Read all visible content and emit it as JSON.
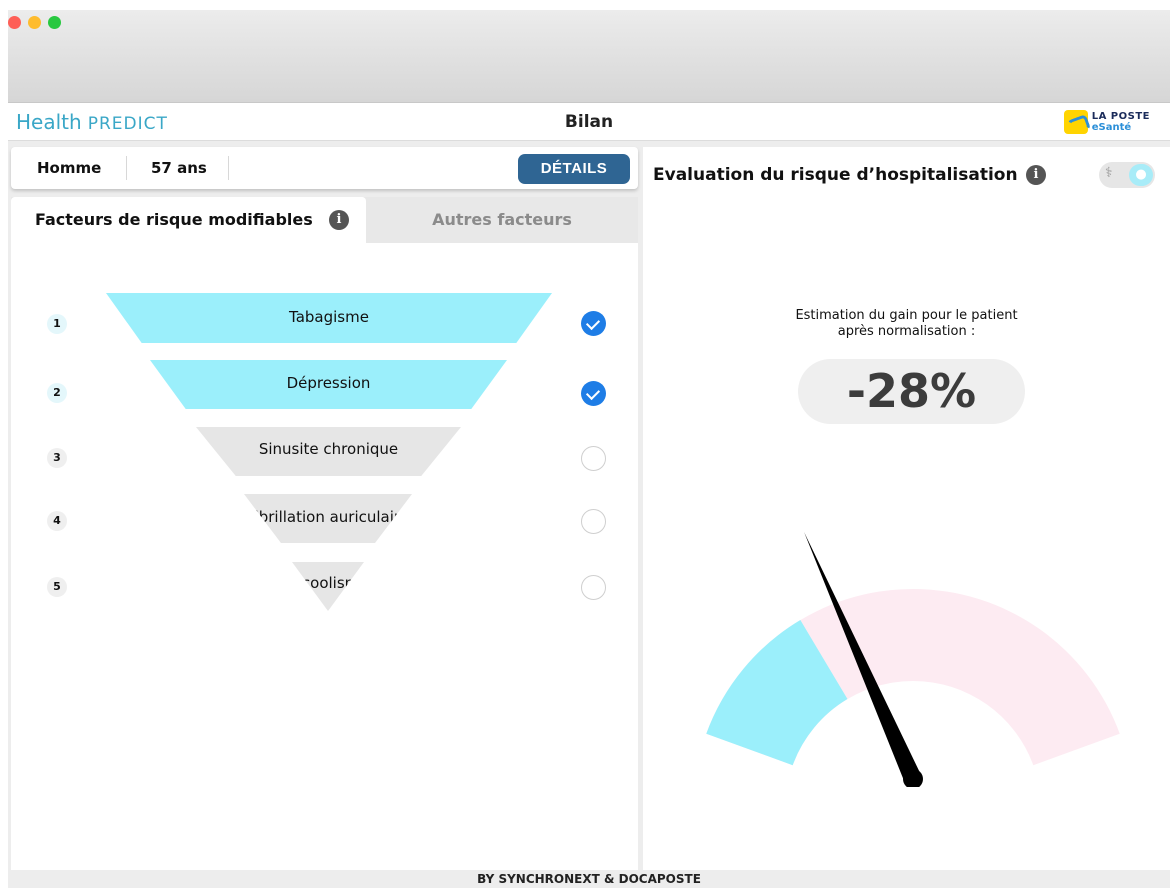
{
  "window": {
    "traffic_lights": [
      "close",
      "minimize",
      "zoom"
    ]
  },
  "header": {
    "logo_health": "Health",
    "logo_predict": "PREDICT",
    "page_title": "Bilan",
    "partner_line1": "LA POSTE",
    "partner_line2": "eSanté"
  },
  "patient": {
    "sex": "Homme",
    "age": "57 ans",
    "details_label": "DÉTAILS"
  },
  "tabs": {
    "active_label": "Facteurs de risque modifiables",
    "inactive_label": "Autres facteurs",
    "info_glyph": "i"
  },
  "factors": [
    {
      "rank": "1",
      "label": "Tabagisme",
      "checked": true
    },
    {
      "rank": "2",
      "label": "Dépression",
      "checked": true
    },
    {
      "rank": "3",
      "label": "Sinusite chronique",
      "checked": false
    },
    {
      "rank": "4",
      "label": "Fibrillation auriculaire",
      "checked": false
    },
    {
      "rank": "5",
      "label": "Alcoolisme",
      "checked": false
    }
  ],
  "evaluation": {
    "title": "Evaluation du risque d’hospitalisation",
    "info_glyph": "i",
    "gain_line1": "Estimation du gain pour le patient",
    "gain_line2": "après normalisation :",
    "gain_value": "-28%",
    "gauge_fill_fraction": 0.28,
    "needle_fraction": 0.33
  },
  "colors": {
    "accent_cyan": "#9beffb",
    "inactive_grey": "#e6e6e6",
    "check_blue": "#1e7de6",
    "gauge_pink": "#fdebf2",
    "button_blue": "#2f6593"
  },
  "toggle": {
    "left_icon": "stethoscope-icon",
    "right_icon": "person-icon"
  },
  "footer": {
    "text": "BY SYNCHRONEXT & DOCAPOSTE"
  }
}
